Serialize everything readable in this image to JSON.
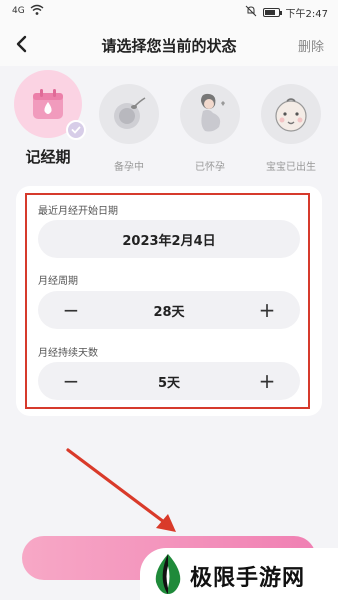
{
  "statusbar": {
    "signal": "4G",
    "time": "下午2:47",
    "battery_level": 0.8
  },
  "navbar": {
    "title": "请选择您当前的状态",
    "delete_label": "删除"
  },
  "status_options": [
    {
      "label": "记经期",
      "selected": true,
      "icon": "calendar-drop-icon"
    },
    {
      "label": "备孕中",
      "selected": false,
      "icon": "sperm-egg-icon"
    },
    {
      "label": "已怀孕",
      "selected": false,
      "icon": "pregnant-woman-icon"
    },
    {
      "label": "宝宝已出生",
      "selected": false,
      "icon": "baby-face-icon"
    }
  ],
  "form": {
    "last_period": {
      "label": "最近月经开始日期",
      "value": "2023年2月4日"
    },
    "cycle": {
      "label": "月经周期",
      "value": "28天"
    },
    "duration": {
      "label": "月经持续天数",
      "value": "5天"
    }
  },
  "watermark": {
    "text": "极限手游网"
  },
  "colors": {
    "accent_pink": "#f080b3",
    "highlight_red": "#d63a2c",
    "arrow_red": "#d93a2a"
  }
}
